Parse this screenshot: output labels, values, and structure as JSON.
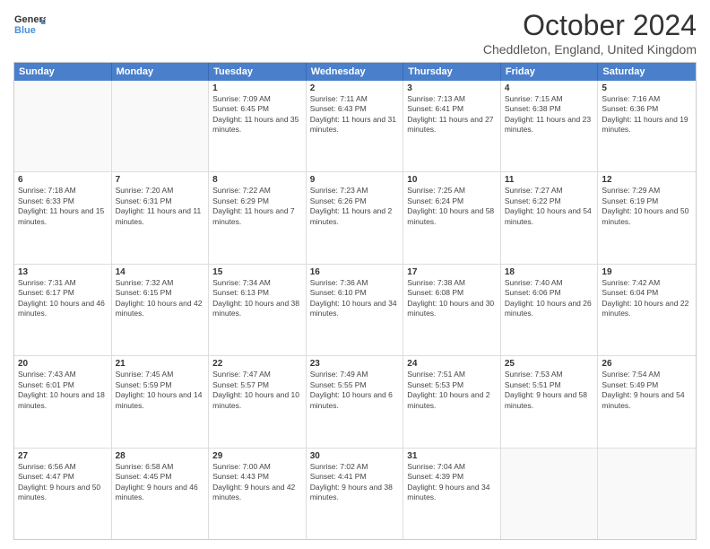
{
  "header": {
    "logo_line1": "General",
    "logo_line2": "Blue",
    "month_title": "October 2024",
    "location": "Cheddleton, England, United Kingdom"
  },
  "days": [
    "Sunday",
    "Monday",
    "Tuesday",
    "Wednesday",
    "Thursday",
    "Friday",
    "Saturday"
  ],
  "rows": [
    [
      {
        "day": "",
        "content": ""
      },
      {
        "day": "",
        "content": ""
      },
      {
        "day": "1",
        "content": "Sunrise: 7:09 AM\nSunset: 6:45 PM\nDaylight: 11 hours and 35 minutes."
      },
      {
        "day": "2",
        "content": "Sunrise: 7:11 AM\nSunset: 6:43 PM\nDaylight: 11 hours and 31 minutes."
      },
      {
        "day": "3",
        "content": "Sunrise: 7:13 AM\nSunset: 6:41 PM\nDaylight: 11 hours and 27 minutes."
      },
      {
        "day": "4",
        "content": "Sunrise: 7:15 AM\nSunset: 6:38 PM\nDaylight: 11 hours and 23 minutes."
      },
      {
        "day": "5",
        "content": "Sunrise: 7:16 AM\nSunset: 6:36 PM\nDaylight: 11 hours and 19 minutes."
      }
    ],
    [
      {
        "day": "6",
        "content": "Sunrise: 7:18 AM\nSunset: 6:33 PM\nDaylight: 11 hours and 15 minutes."
      },
      {
        "day": "7",
        "content": "Sunrise: 7:20 AM\nSunset: 6:31 PM\nDaylight: 11 hours and 11 minutes."
      },
      {
        "day": "8",
        "content": "Sunrise: 7:22 AM\nSunset: 6:29 PM\nDaylight: 11 hours and 7 minutes."
      },
      {
        "day": "9",
        "content": "Sunrise: 7:23 AM\nSunset: 6:26 PM\nDaylight: 11 hours and 2 minutes."
      },
      {
        "day": "10",
        "content": "Sunrise: 7:25 AM\nSunset: 6:24 PM\nDaylight: 10 hours and 58 minutes."
      },
      {
        "day": "11",
        "content": "Sunrise: 7:27 AM\nSunset: 6:22 PM\nDaylight: 10 hours and 54 minutes."
      },
      {
        "day": "12",
        "content": "Sunrise: 7:29 AM\nSunset: 6:19 PM\nDaylight: 10 hours and 50 minutes."
      }
    ],
    [
      {
        "day": "13",
        "content": "Sunrise: 7:31 AM\nSunset: 6:17 PM\nDaylight: 10 hours and 46 minutes."
      },
      {
        "day": "14",
        "content": "Sunrise: 7:32 AM\nSunset: 6:15 PM\nDaylight: 10 hours and 42 minutes."
      },
      {
        "day": "15",
        "content": "Sunrise: 7:34 AM\nSunset: 6:13 PM\nDaylight: 10 hours and 38 minutes."
      },
      {
        "day": "16",
        "content": "Sunrise: 7:36 AM\nSunset: 6:10 PM\nDaylight: 10 hours and 34 minutes."
      },
      {
        "day": "17",
        "content": "Sunrise: 7:38 AM\nSunset: 6:08 PM\nDaylight: 10 hours and 30 minutes."
      },
      {
        "day": "18",
        "content": "Sunrise: 7:40 AM\nSunset: 6:06 PM\nDaylight: 10 hours and 26 minutes."
      },
      {
        "day": "19",
        "content": "Sunrise: 7:42 AM\nSunset: 6:04 PM\nDaylight: 10 hours and 22 minutes."
      }
    ],
    [
      {
        "day": "20",
        "content": "Sunrise: 7:43 AM\nSunset: 6:01 PM\nDaylight: 10 hours and 18 minutes."
      },
      {
        "day": "21",
        "content": "Sunrise: 7:45 AM\nSunset: 5:59 PM\nDaylight: 10 hours and 14 minutes."
      },
      {
        "day": "22",
        "content": "Sunrise: 7:47 AM\nSunset: 5:57 PM\nDaylight: 10 hours and 10 minutes."
      },
      {
        "day": "23",
        "content": "Sunrise: 7:49 AM\nSunset: 5:55 PM\nDaylight: 10 hours and 6 minutes."
      },
      {
        "day": "24",
        "content": "Sunrise: 7:51 AM\nSunset: 5:53 PM\nDaylight: 10 hours and 2 minutes."
      },
      {
        "day": "25",
        "content": "Sunrise: 7:53 AM\nSunset: 5:51 PM\nDaylight: 9 hours and 58 minutes."
      },
      {
        "day": "26",
        "content": "Sunrise: 7:54 AM\nSunset: 5:49 PM\nDaylight: 9 hours and 54 minutes."
      }
    ],
    [
      {
        "day": "27",
        "content": "Sunrise: 6:56 AM\nSunset: 4:47 PM\nDaylight: 9 hours and 50 minutes."
      },
      {
        "day": "28",
        "content": "Sunrise: 6:58 AM\nSunset: 4:45 PM\nDaylight: 9 hours and 46 minutes."
      },
      {
        "day": "29",
        "content": "Sunrise: 7:00 AM\nSunset: 4:43 PM\nDaylight: 9 hours and 42 minutes."
      },
      {
        "day": "30",
        "content": "Sunrise: 7:02 AM\nSunset: 4:41 PM\nDaylight: 9 hours and 38 minutes."
      },
      {
        "day": "31",
        "content": "Sunrise: 7:04 AM\nSunset: 4:39 PM\nDaylight: 9 hours and 34 minutes."
      },
      {
        "day": "",
        "content": ""
      },
      {
        "day": "",
        "content": ""
      }
    ]
  ]
}
